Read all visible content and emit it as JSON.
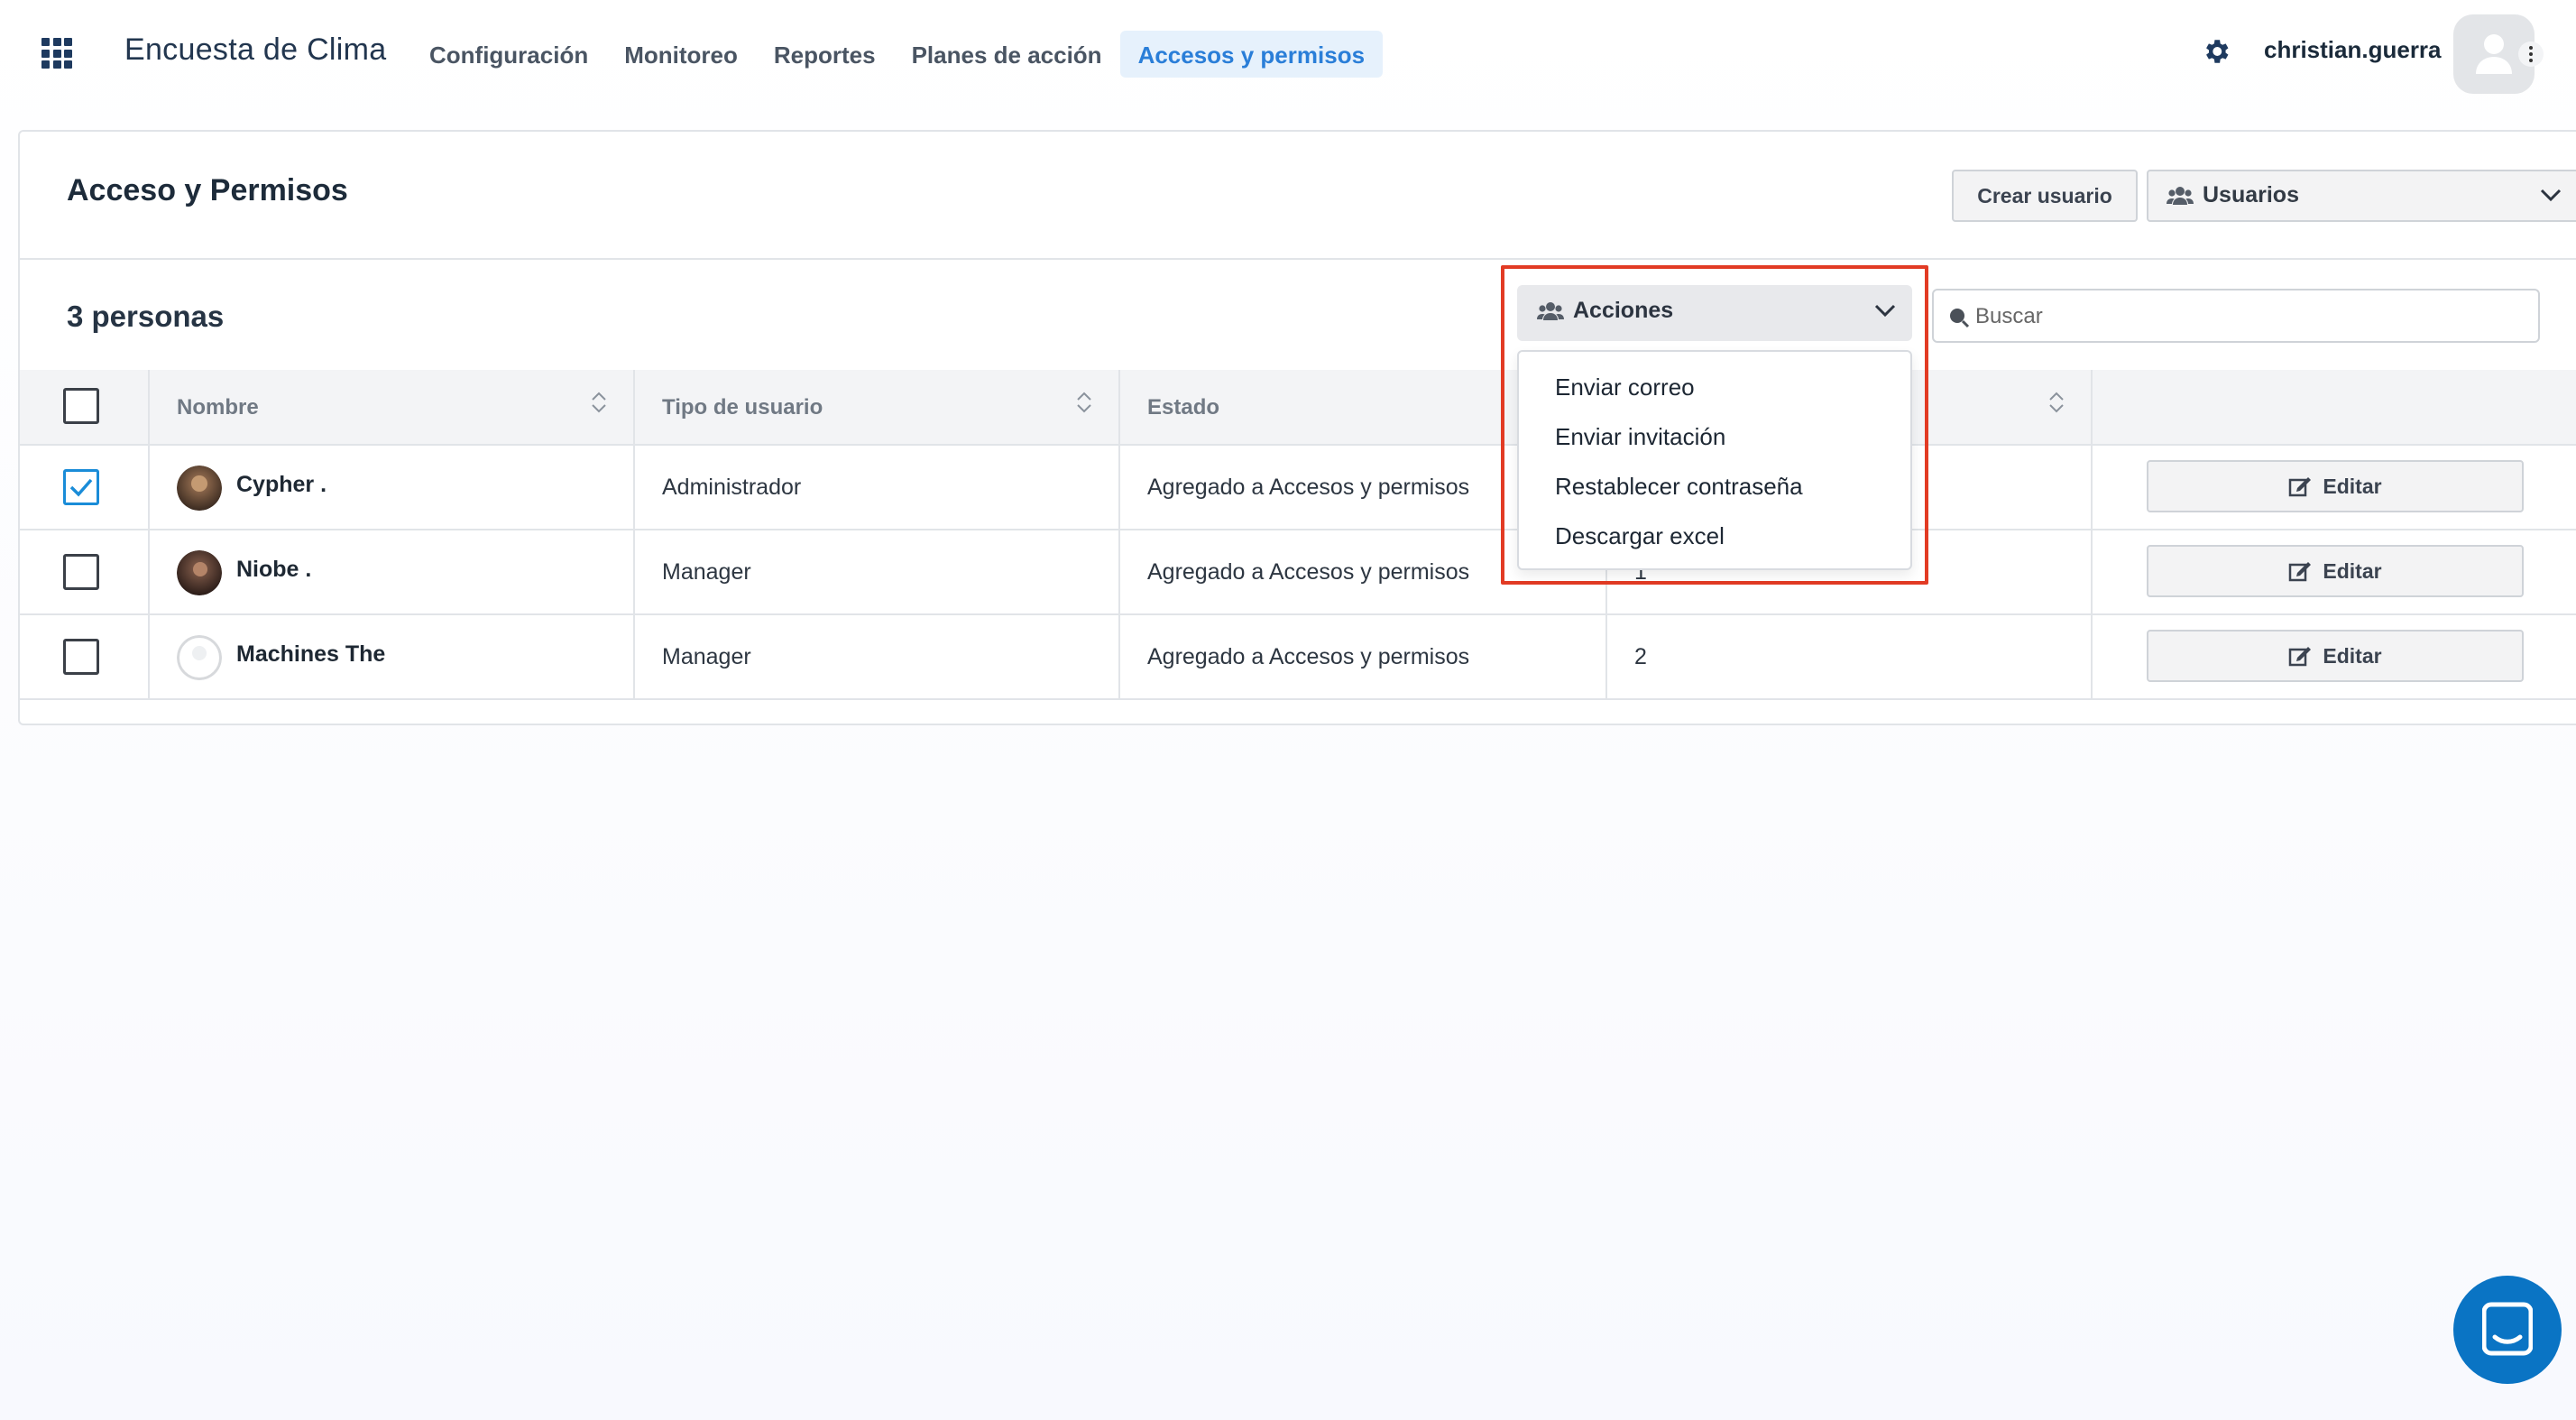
{
  "header": {
    "brand": "Encuesta de Clima",
    "nav": [
      {
        "label": "Configuración",
        "active": false
      },
      {
        "label": "Monitoreo",
        "active": false
      },
      {
        "label": "Reportes",
        "active": false
      },
      {
        "label": "Planes de acción",
        "active": false
      },
      {
        "label": "Accesos y permisos",
        "active": true
      }
    ],
    "username": "christian.guerra",
    "icons": [
      "apps-grid-icon",
      "gear-icon",
      "user-avatar-icon",
      "kebab-icon"
    ]
  },
  "page": {
    "title": "Acceso y Permisos",
    "create_button": "Crear usuario",
    "users_select": "Usuarios",
    "count_label": "3 personas",
    "search_placeholder": "Buscar"
  },
  "actions": {
    "label": "Acciones",
    "items": [
      "Enviar correo",
      "Enviar invitación",
      "Restablecer contraseña",
      "Descargar excel"
    ]
  },
  "table": {
    "columns": [
      "Nombre",
      "Tipo de usuario",
      "Estado",
      ""
    ],
    "rows": [
      {
        "name": "Cypher .",
        "type": "Administrador",
        "status": "Agregado a Accesos y permisos",
        "col4": "",
        "checked": true,
        "edit": "Editar"
      },
      {
        "name": "Niobe .",
        "type": "Manager",
        "status": "Agregado a Accesos y permisos",
        "col4": "1",
        "checked": false,
        "edit": "Editar"
      },
      {
        "name": "Machines The",
        "type": "Manager",
        "status": "Agregado a Accesos y permisos",
        "col4": "2",
        "checked": false,
        "edit": "Editar"
      }
    ]
  },
  "colors": {
    "accent": "#2a7ed8",
    "highlight": "#e23b24",
    "chat": "#0a74c4"
  }
}
